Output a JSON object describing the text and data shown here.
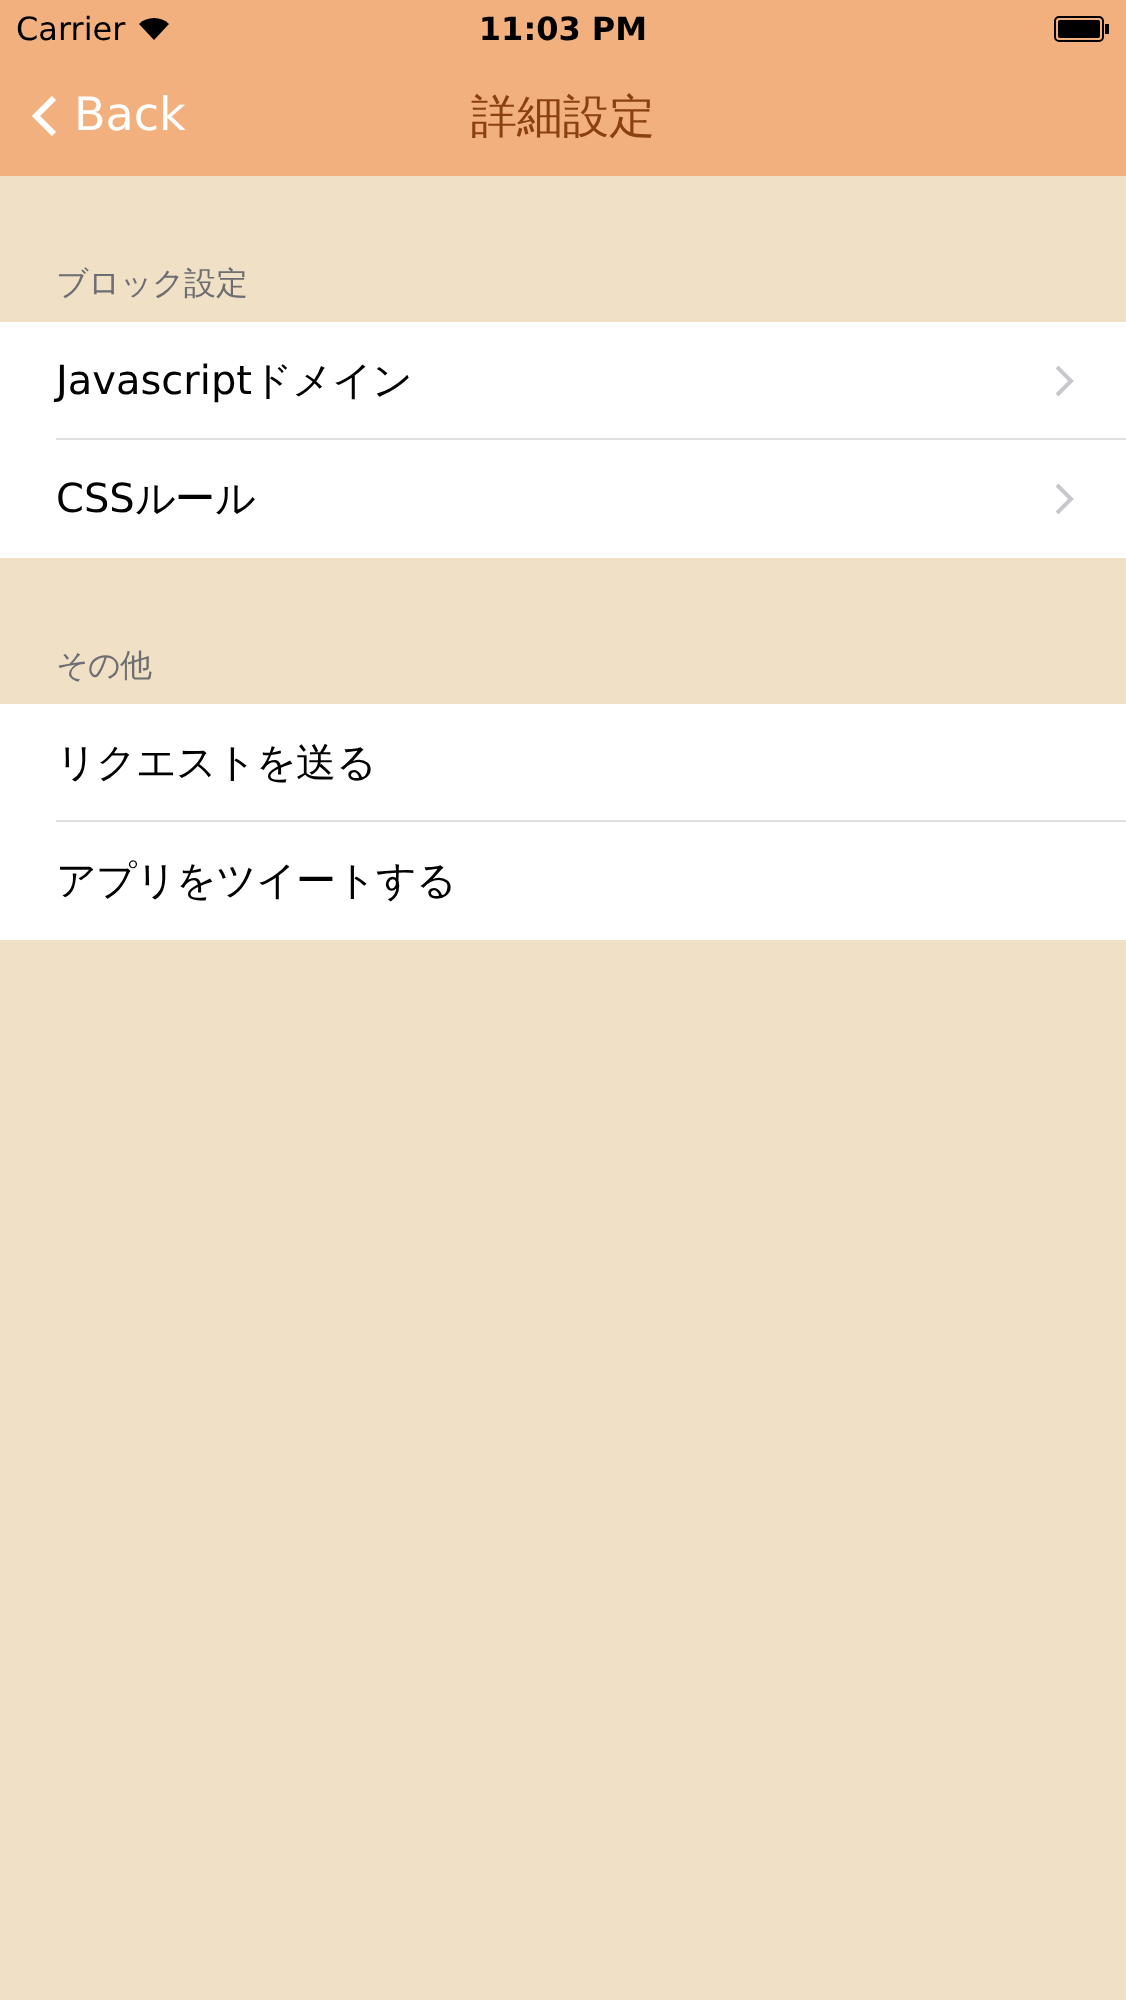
{
  "status_bar": {
    "carrier": "Carrier",
    "time": "11:03 PM"
  },
  "nav_bar": {
    "back": "Back",
    "title": "詳細設定"
  },
  "sections": [
    {
      "header": "ブロック設定",
      "rows": [
        {
          "label": "Javascriptドメイン",
          "disclosure": true
        },
        {
          "label": "CSSルール",
          "disclosure": true
        }
      ]
    },
    {
      "header": "その他",
      "rows": [
        {
          "label": "リクエストを送る",
          "disclosure": false
        },
        {
          "label": "アプリをツイートする",
          "disclosure": false
        }
      ]
    }
  ]
}
